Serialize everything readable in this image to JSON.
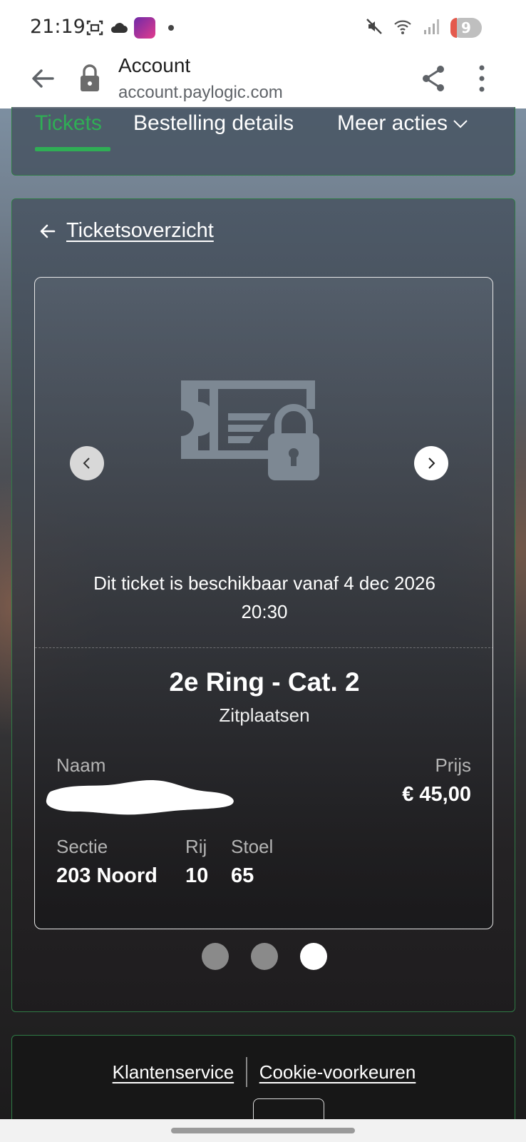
{
  "status_bar": {
    "time": "21:19",
    "icons_left": [
      "screenshot-icon",
      "cloud-icon",
      "app-badge-icon",
      "notification-dot-icon"
    ],
    "icons_right": [
      "mute-icon",
      "wifi-icon",
      "signal-icon"
    ],
    "battery": "9"
  },
  "browser": {
    "title": "Account",
    "url": "account.paylogic.com"
  },
  "tabs": {
    "items": [
      {
        "label": "Tickets",
        "active": true
      },
      {
        "label": "Bestelling details",
        "active": false
      },
      {
        "label": "Meer acties",
        "active": false
      }
    ]
  },
  "ticket_view": {
    "back_label": "Ticketsoverzicht",
    "availability_line1": "Dit ticket is beschikbaar vanaf 4 dec 2026",
    "availability_line2": "20:30",
    "title": "2e Ring - Cat. 2",
    "subtitle": "Zitplaatsen",
    "name_label": "Naam",
    "price_label": "Prijs",
    "price_value": "€ 45,00",
    "section_label": "Sectie",
    "section_value": "203 Noord",
    "row_label": "Rij",
    "row_value": "10",
    "seat_label": "Stoel",
    "seat_value": "65",
    "pager": {
      "count": 3,
      "active_index": 2
    }
  },
  "footer": {
    "link_1": "Klantenservice",
    "link_2": "Cookie-voorkeuren"
  },
  "colors": {
    "accent_green": "#2fae55",
    "card_border": "#2f7a45"
  }
}
